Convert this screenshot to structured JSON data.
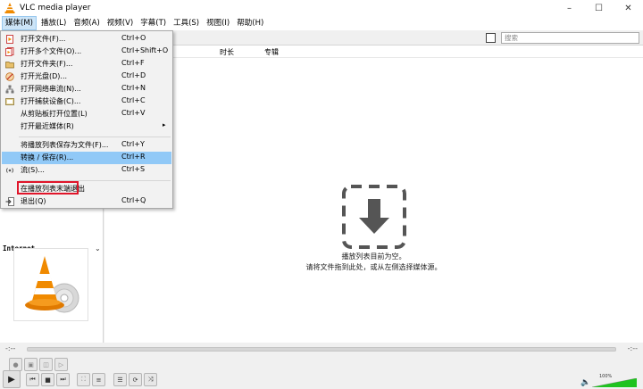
{
  "window": {
    "title": "VLC media player"
  },
  "menubar": [
    "媒体(M)",
    "播放(L)",
    "音频(A)",
    "视频(V)",
    "字幕(T)",
    "工具(S)",
    "视图(I)",
    "帮助(H)"
  ],
  "window_buttons": {
    "minimize": "–",
    "maximize": "☐",
    "close": "✕"
  },
  "dropdown": {
    "items": [
      {
        "label": "打开文件(F)...",
        "shortcut": "Ctrl+O",
        "icon": "file-icon"
      },
      {
        "label": "打开多个文件(O)...",
        "shortcut": "Ctrl+Shift+O",
        "icon": "files-icon"
      },
      {
        "label": "打开文件夹(F)...",
        "shortcut": "Ctrl+F",
        "icon": "folder-icon"
      },
      {
        "label": "打开光盘(D)...",
        "shortcut": "Ctrl+D",
        "icon": "disc-icon"
      },
      {
        "label": "打开网络串流(N)...",
        "shortcut": "Ctrl+N",
        "icon": "network-icon"
      },
      {
        "label": "打开捕获设备(C)...",
        "shortcut": "Ctrl+C",
        "icon": "capture-icon"
      },
      {
        "label": "从剪贴板打开位置(L)",
        "shortcut": "Ctrl+V",
        "icon": ""
      },
      {
        "label": "打开最近媒体(R)",
        "shortcut": "",
        "icon": "",
        "submenu_arrow": "▸"
      },
      {
        "label": "将播放列表保存为文件(F)...",
        "shortcut": "Ctrl+Y",
        "icon": ""
      },
      {
        "label": "转换 / 保存(R)...",
        "shortcut": "Ctrl+R",
        "icon": "",
        "highlighted": true
      },
      {
        "label": "流(S)...",
        "shortcut": "Ctrl+S",
        "icon": "stream-icon"
      },
      {
        "label": "在播放列表末端退出",
        "shortcut": "",
        "icon": ""
      },
      {
        "label": "退出(Q)",
        "shortcut": "Ctrl+Q",
        "icon": "exit-icon"
      }
    ]
  },
  "playlist": {
    "search_placeholder": "搜索",
    "columns": [
      "时长",
      "专辑"
    ],
    "empty_line1": "播放列表目前为空。",
    "empty_line2": "请将文件拖到此处，或从左侧选择媒体源。"
  },
  "sidebar": {
    "internet_label": "Internet",
    "chevron": "⌄"
  },
  "seek": {
    "time_left": "-:--",
    "time_right": "-:--"
  },
  "volume": {
    "percent": "100%",
    "level": 1.0
  },
  "colors": {
    "highlight": "#91c9f7",
    "red_box": "#e0152a",
    "vlc_orange": "#f08a00",
    "volume_green": "#1fc31f"
  }
}
